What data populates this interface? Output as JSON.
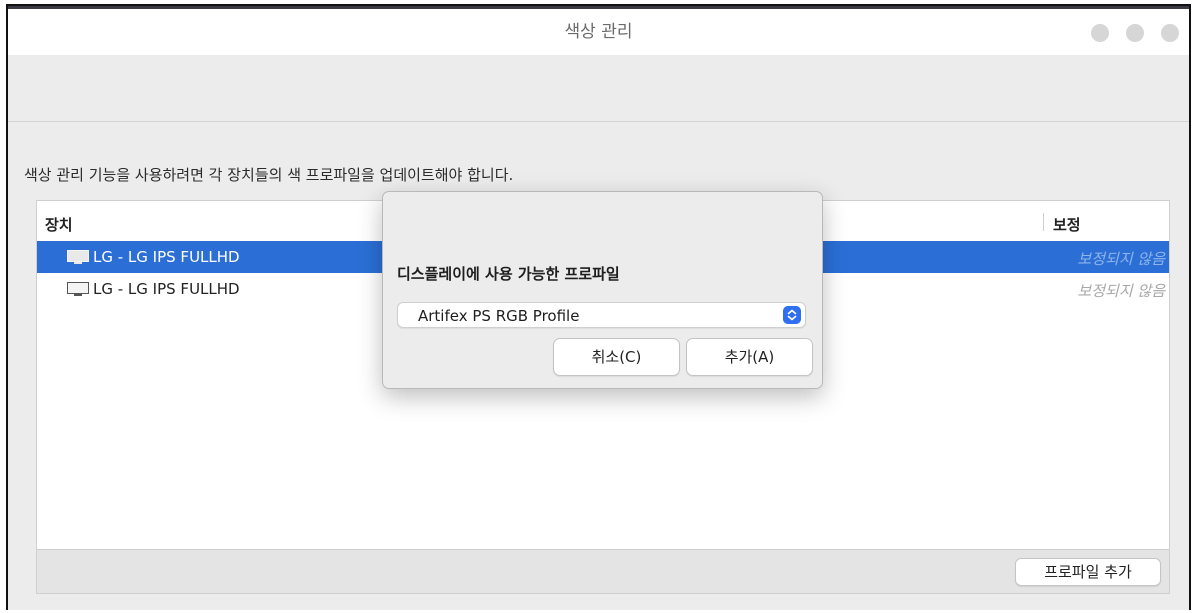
{
  "window": {
    "title": "색상 관리"
  },
  "content": {
    "description": "색상 관리 기능을 사용하려면 각 장치들의 색 프로파일을 업데이트해야 합니다.",
    "table": {
      "columns": [
        "장치",
        "보정"
      ],
      "rows": [
        {
          "device": "LG - LG IPS FULLHD",
          "calibration": "보정되지 않음",
          "selected": true
        },
        {
          "device": "LG - LG IPS FULLHD",
          "calibration": "보정되지 않음",
          "selected": false
        }
      ]
    },
    "add_profile_label": "프로파일 추가"
  },
  "dialog": {
    "heading": "디스플레이에 사용 가능한 프로파일",
    "profile_select_value": "Artifex PS RGB Profile",
    "cancel_label": "취소(C)",
    "add_label": "추가(A)"
  },
  "colors": {
    "accent": "#2b6fd6",
    "select_chevron": "#2f6ff0"
  },
  "icons": [
    "monitor-icon",
    "updown-chevron-icon"
  ]
}
